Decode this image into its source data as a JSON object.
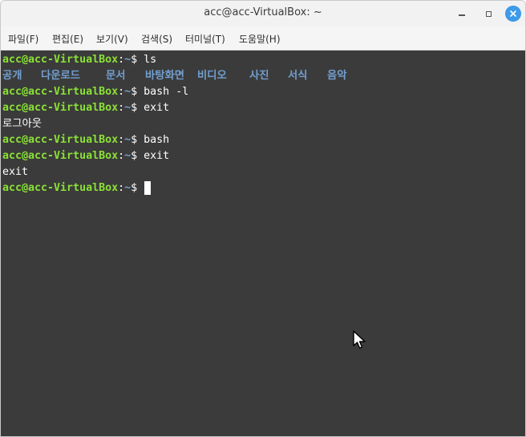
{
  "window": {
    "title": "acc@acc-VirtualBox: ~"
  },
  "menubar": {
    "items": [
      "파일(F)",
      "편집(E)",
      "보기(V)",
      "검색(S)",
      "터미널(T)",
      "도움말(H)"
    ]
  },
  "terminal": {
    "prompt_user": "acc@acc-VirtualBox",
    "prompt_path": "~",
    "prompt_sep": ":",
    "prompt_symbol": "$",
    "lines": [
      {
        "type": "cmd",
        "text": " ls"
      },
      {
        "type": "dirs",
        "items": [
          "공개",
          "다운로드",
          "문서",
          "바탕화면",
          "비디오",
          "사진",
          "서식",
          "음악"
        ]
      },
      {
        "type": "cmd",
        "text": " bash -l"
      },
      {
        "type": "cmd",
        "text": " exit"
      },
      {
        "type": "out",
        "text": "로그아웃"
      },
      {
        "type": "cmd",
        "text": " bash"
      },
      {
        "type": "cmd",
        "text": " exit"
      },
      {
        "type": "out",
        "text": "exit"
      },
      {
        "type": "cursor",
        "text": " "
      }
    ]
  }
}
